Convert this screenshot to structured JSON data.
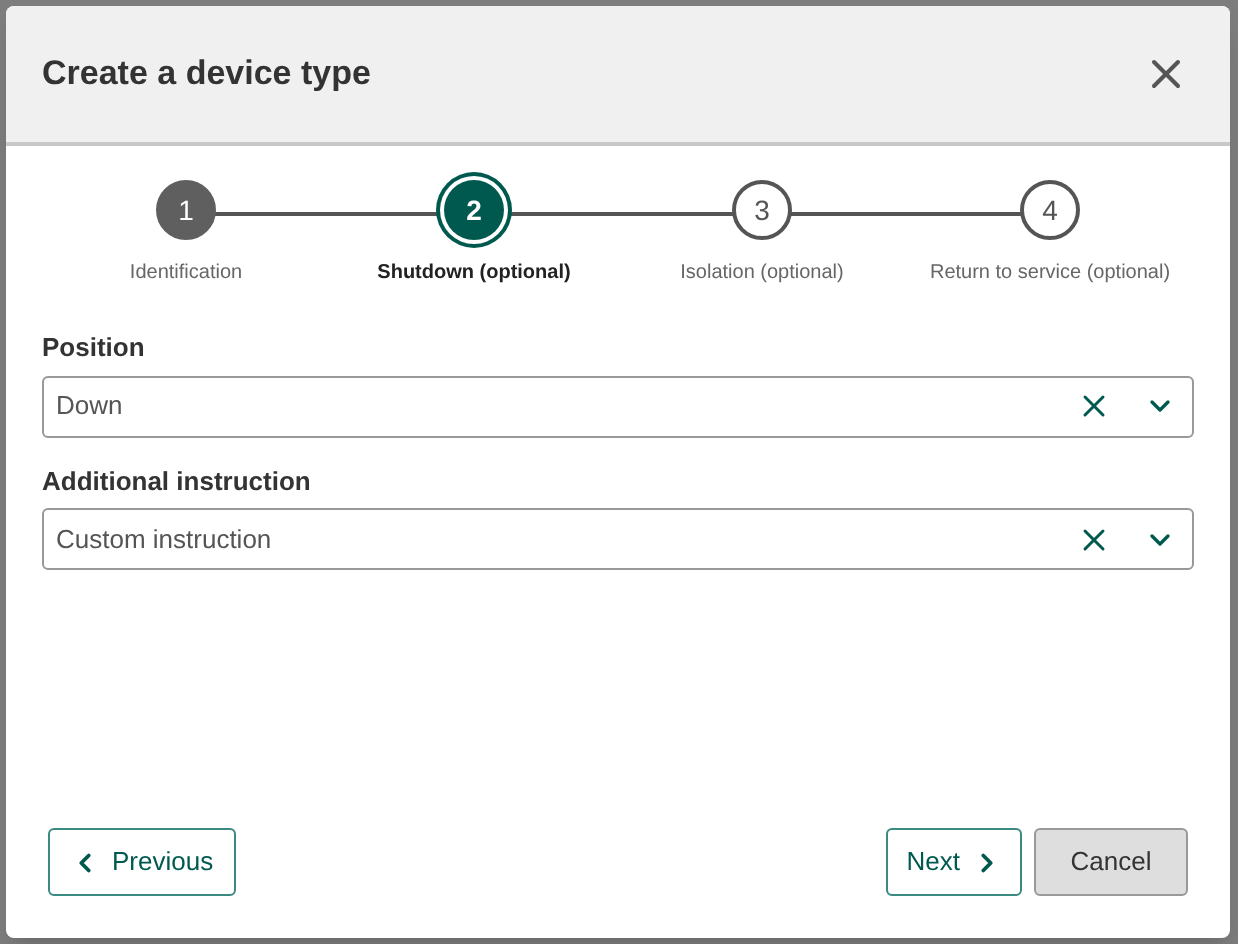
{
  "dialog": {
    "title": "Create a device type"
  },
  "steps": [
    {
      "number": "1",
      "label": "Identification",
      "completed": true,
      "selected": false
    },
    {
      "number": "2",
      "label": "Shutdown (optional)",
      "completed": false,
      "selected": true
    },
    {
      "number": "3",
      "label": "Isolation (optional)",
      "completed": false,
      "selected": false
    },
    {
      "number": "4",
      "label": "Return to service (optional)",
      "completed": false,
      "selected": false
    }
  ],
  "fields": [
    {
      "label": "Position",
      "value": "Down"
    },
    {
      "label": "Additional instruction",
      "value": "Custom instruction"
    }
  ],
  "buttons": {
    "previous": "Previous",
    "next": "Next",
    "cancel": "Cancel"
  }
}
